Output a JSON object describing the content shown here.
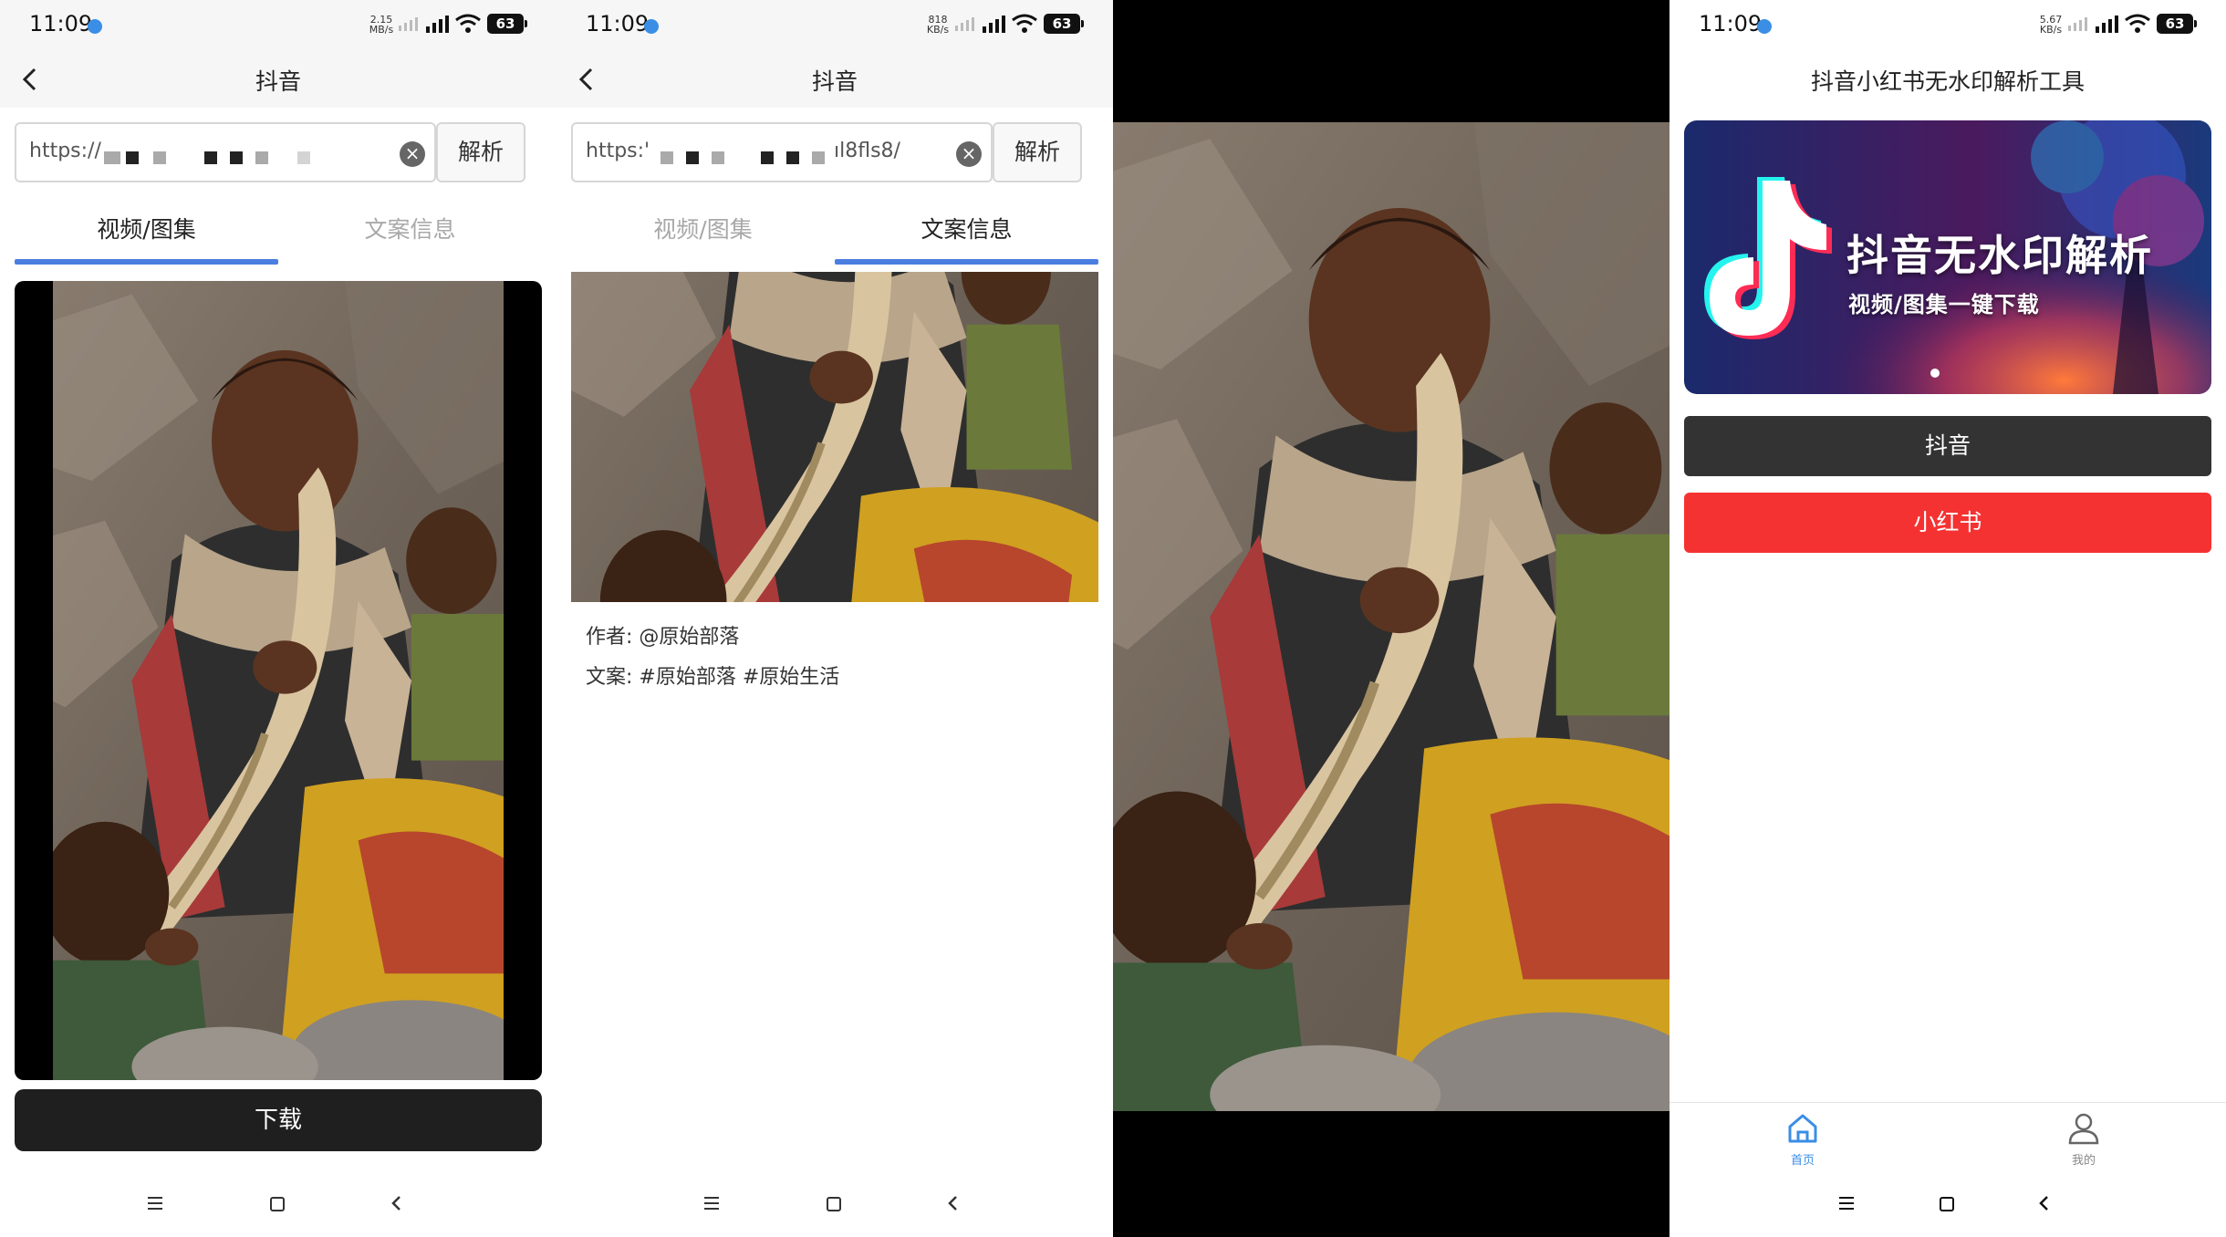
{
  "status_bar": {
    "time": "11:09",
    "speeds": [
      "2.15\nMB/s",
      "818\nKB/s",
      "",
      "5.67\nKB/s"
    ],
    "battery": "63"
  },
  "panel1": {
    "nav_title": "抖音",
    "url_value": "https://",
    "parse_label": "解析",
    "tabs": [
      "视频/图集",
      "文案信息"
    ],
    "download_label": "下载"
  },
  "panel2": {
    "nav_title": "抖音",
    "url_value_start": "https:'",
    "url_value_end": "ıl8fls8/",
    "parse_label": "解析",
    "tabs": [
      "视频/图集",
      "文案信息"
    ],
    "author_line": "作者: @原始部落",
    "caption_line": "文案: #原始部落 #原始生活"
  },
  "panel4": {
    "title": "抖音小红书无水印解析工具",
    "banner_title": "抖音无水印解析",
    "banner_subtitle": "视频/图集一键下载",
    "douyin_button": "抖音",
    "xiaohongshu_button": "小红书",
    "tabbar": [
      "首页",
      "我的"
    ]
  },
  "colors": {
    "tab_indicator": "#4a7ee0",
    "download_button": "#1f1f1f",
    "douyin_button": "#333333",
    "xiaohongshu_button": "#f53232",
    "active_tab_icon": "#3a8ee6"
  },
  "icons": [
    "back-arrow-icon",
    "clear-icon",
    "home-icon",
    "profile-icon",
    "wifi-icon",
    "signal-icon",
    "battery-icon",
    "tiktok-logo-icon"
  ]
}
